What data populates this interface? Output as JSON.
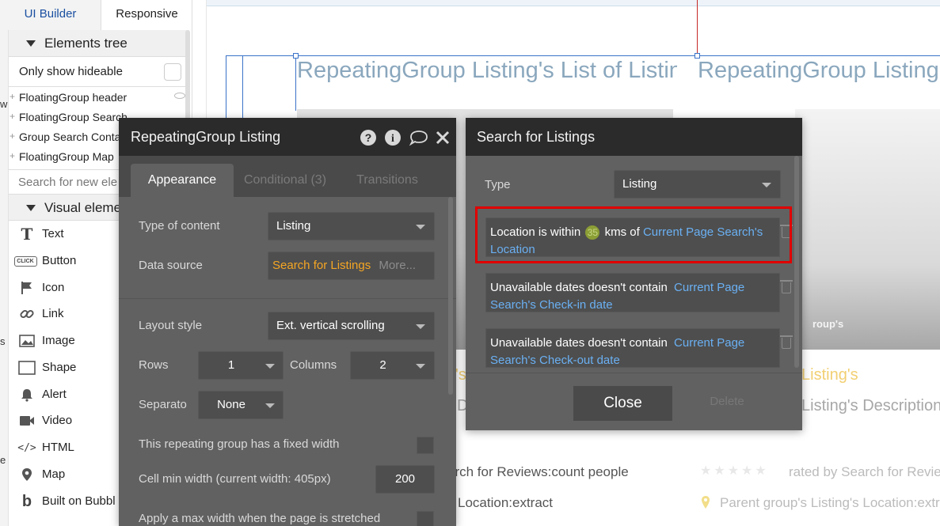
{
  "left_panel": {
    "tabs": {
      "ui_builder": "UI Builder",
      "responsive": "Responsive"
    },
    "gutter_chars": [
      "w",
      "s",
      "e"
    ],
    "elements_tree": {
      "title": "Elements tree",
      "only_show_hideable": "Only show hideable",
      "items": [
        "FloatingGroup header",
        "FloatingGroup Search",
        "Group Search Conta",
        "FloatingGroup Map"
      ]
    },
    "search_new_elements_placeholder": "Search for new ele",
    "visual_elements": {
      "title": "Visual eleme",
      "items": [
        {
          "label": "Text",
          "icon": "text-icon"
        },
        {
          "label": "Button",
          "icon": "button-icon"
        },
        {
          "label": "Icon",
          "icon": "flag-icon"
        },
        {
          "label": "Link",
          "icon": "link-icon"
        },
        {
          "label": "Image",
          "icon": "image-icon"
        },
        {
          "label": "Shape",
          "icon": "shape-icon"
        },
        {
          "label": "Alert",
          "icon": "bell-icon"
        },
        {
          "label": "Video",
          "icon": "video-icon"
        },
        {
          "label": "HTML",
          "icon": "code-icon"
        },
        {
          "label": "Map",
          "icon": "map-pin-icon"
        },
        {
          "label": "Built on Bubbl",
          "icon": "bubble-icon"
        }
      ],
      "button_icon_text": "CLICK"
    }
  },
  "canvas": {
    "rg_title_left": "RepeatingGroup Listing's List of Listings",
    "rg_title_right": "RepeatingGroup Listing's List of Listings",
    "img_right_text": "roup's",
    "listing_left_fragment": "'s",
    "listing_right": "Listing's",
    "desc_left_fragment": "D",
    "desc_right": "Listing's Description",
    "reviews_left": "arch for Reviews:count people",
    "reviews_right": "rated by Search for Review",
    "stars": "★★★★★",
    "location_left": "Location:extract",
    "location_right": "Parent group's Listing's Location:extrac"
  },
  "prop_editor": {
    "title": "RepeatingGroup Listing",
    "tabs": {
      "appearance": "Appearance",
      "conditional": "Conditional (3)",
      "transitions": "Transitions"
    },
    "type_of_content": {
      "label": "Type of content",
      "value": "Listing"
    },
    "data_source": {
      "label": "Data source",
      "value": "Search for Listings",
      "more": "More..."
    },
    "layout_style": {
      "label": "Layout style",
      "value": "Ext. vertical scrolling"
    },
    "rows": {
      "label": "Rows",
      "value": "1"
    },
    "columns": {
      "label": "Columns",
      "value": "2"
    },
    "separator": {
      "label": "Separato",
      "value": "None"
    },
    "fixed_width": {
      "label": "This repeating group has a fixed width",
      "checked": false
    },
    "cell_min_width": {
      "label": "Cell min width (current width: 405px)",
      "value": "200"
    },
    "max_width": {
      "label": "Apply a max width when the page is stretched"
    }
  },
  "search_popup": {
    "title": "Search for Listings",
    "type": {
      "label": "Type",
      "value": "Listing"
    },
    "constraints": [
      {
        "prefix": "Location is within",
        "number": "35",
        "middle": "kms of",
        "dynamic": "Current Page Search's Location"
      },
      {
        "prefix": "Unavailable dates doesn't contain",
        "dynamic": "Current Page Search's Check-in date"
      },
      {
        "prefix": "Unavailable dates doesn't contain",
        "dynamic": "Current Page Search's Check-out date"
      }
    ],
    "close_label": "Close",
    "delete_label": "Delete"
  },
  "colors": {
    "panel_bg": "#616161",
    "header_bg": "#2b2b2b",
    "dynamic_link": "#6ab0f3",
    "data_source_orange": "#f5a623",
    "highlight_red": "#e00000",
    "selection_blue": "#3b73c8"
  }
}
